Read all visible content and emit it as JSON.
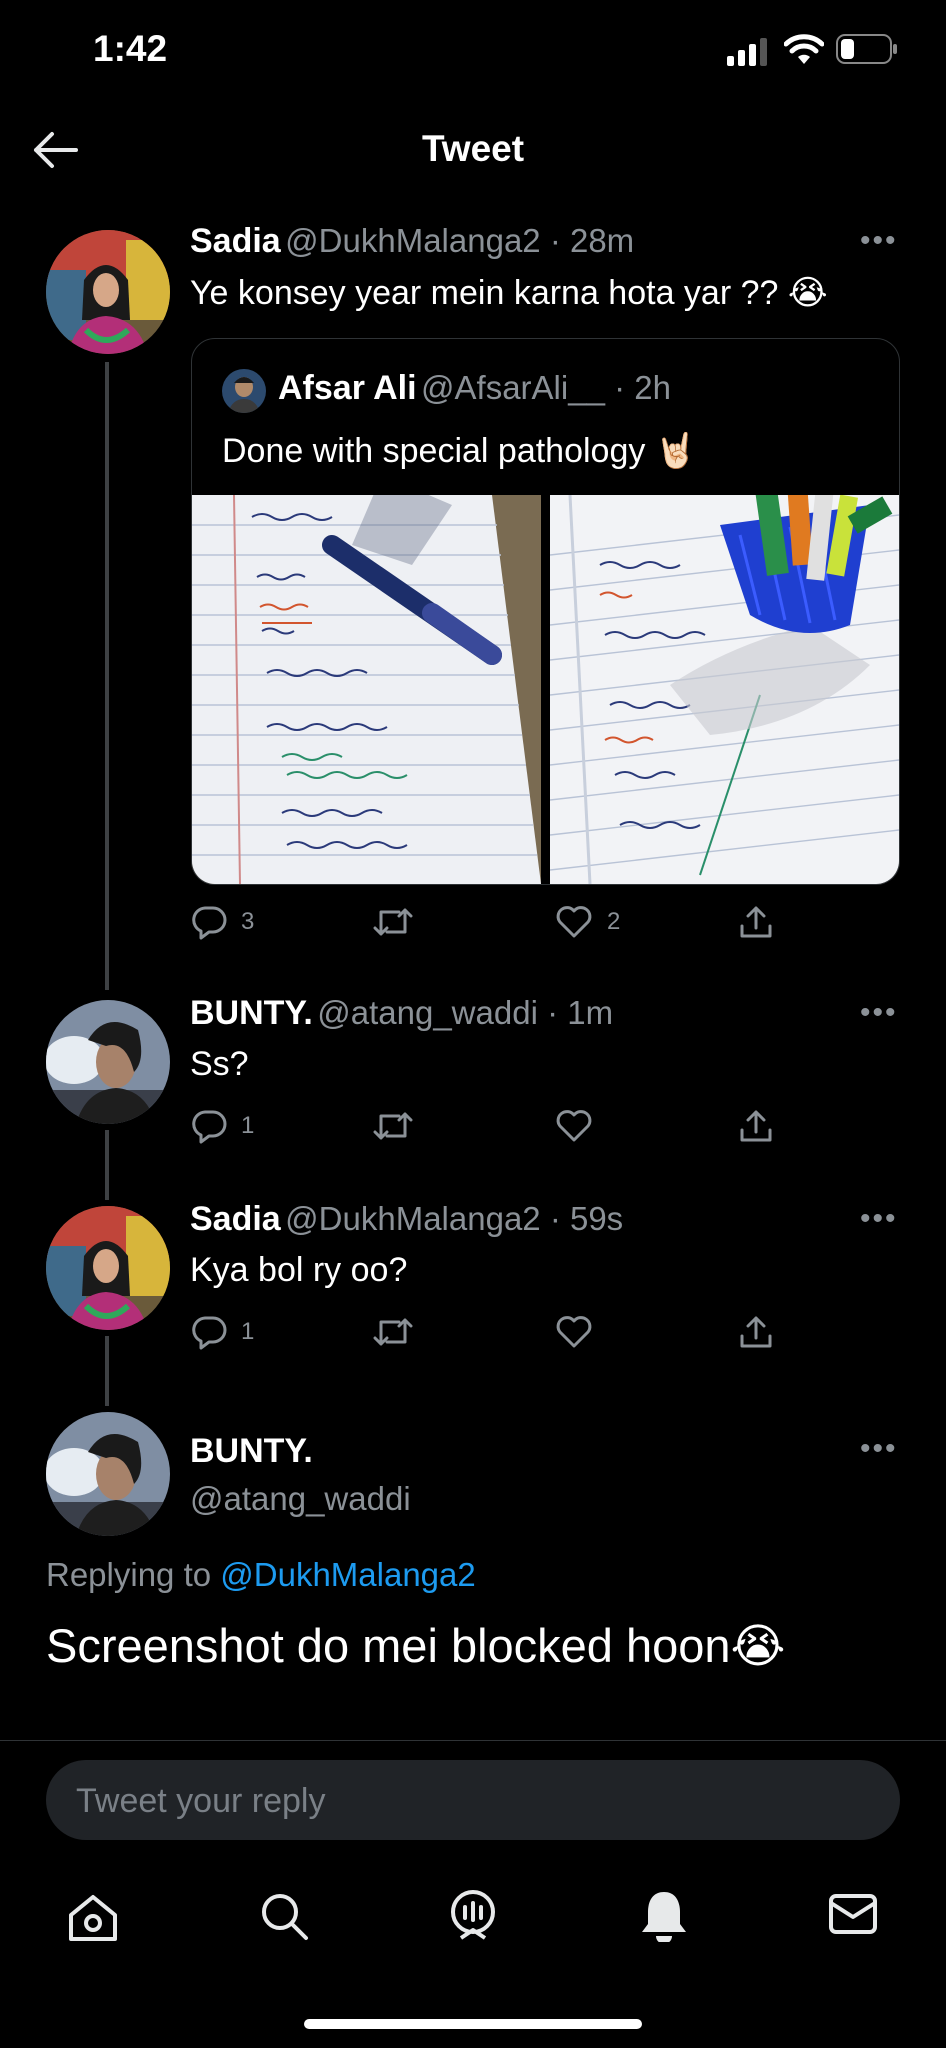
{
  "status": {
    "time": "1:42"
  },
  "header": {
    "title": "Tweet"
  },
  "tweets": [
    {
      "name": "Sadia",
      "handle": "@DukhMalanga2 · 28m",
      "text": "Ye konsey year mein karna hota yar ?? 😭",
      "quote": {
        "name": "Afsar Ali",
        "handle": "@AfsarAli__ · 2h",
        "text": "Done with special pathology 🤘🏻"
      },
      "replies": "3",
      "likes": "2"
    },
    {
      "name": "BUNTY.",
      "handle": "@atang_waddi · 1m",
      "text": "Ss?",
      "replies": "1"
    },
    {
      "name": "Sadia",
      "handle": "@DukhMalanga2 · 59s",
      "text": "Kya bol ry oo?",
      "replies": "1"
    }
  ],
  "main_tweet": {
    "name": "BUNTY.",
    "handle": "@atang_waddi",
    "replying_prefix": "Replying to ",
    "replying_to": "@DukhMalanga2",
    "text": "Screenshot do mei blocked hoon😭"
  },
  "reply_input": {
    "placeholder": "Tweet your reply"
  },
  "colors": {
    "background": "#000000",
    "accent": "#1d9bf0",
    "muted": "#8b9197"
  },
  "icons": [
    "back-arrow-icon",
    "reply-icon",
    "retweet-icon",
    "like-icon",
    "share-icon",
    "home-icon",
    "search-icon",
    "spaces-icon",
    "notifications-icon",
    "messages-icon"
  ]
}
